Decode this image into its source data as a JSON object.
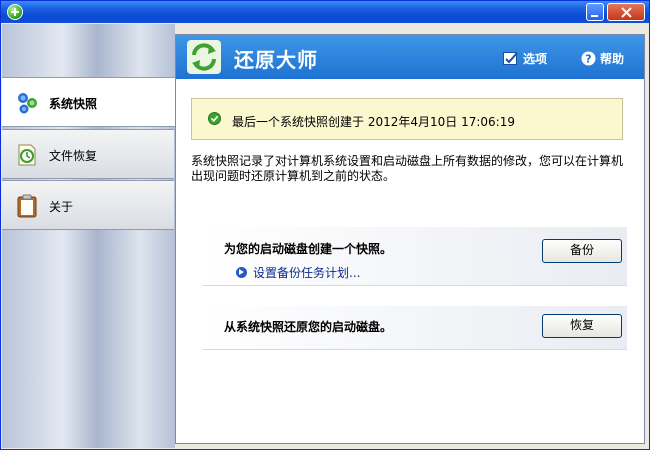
{
  "window": {
    "title": ""
  },
  "header": {
    "title": "还原大师",
    "options_label": "选项",
    "help_label": "帮助"
  },
  "sidebar": {
    "items": [
      {
        "label": "系统快照",
        "icon": "snapshot-icon",
        "active": true
      },
      {
        "label": "文件恢复",
        "icon": "file-restore-icon",
        "active": false
      },
      {
        "label": "关于",
        "icon": "clipboard-icon",
        "active": false
      }
    ]
  },
  "status": {
    "text": "最后一个系统快照创建于 2012年4月10日 17:06:19",
    "icon": "check-circle-icon"
  },
  "description": "系统快照记录了对计算机系统设置和启动磁盘上所有数据的修改，您可以在计算机出现问题时还原计算机到之前的状态。",
  "actions": {
    "backup": {
      "title": "为您的启动磁盘创建一个快照。",
      "button_label": "备份",
      "link_label": "设置备份任务计划..."
    },
    "restore": {
      "title": "从系统快照还原您的启动磁盘。",
      "button_label": "恢复"
    }
  },
  "colors": {
    "header_blue": "#1f72d2",
    "status_bg": "#fbf8d0",
    "titlebar_blue": "#0a4ad5"
  }
}
